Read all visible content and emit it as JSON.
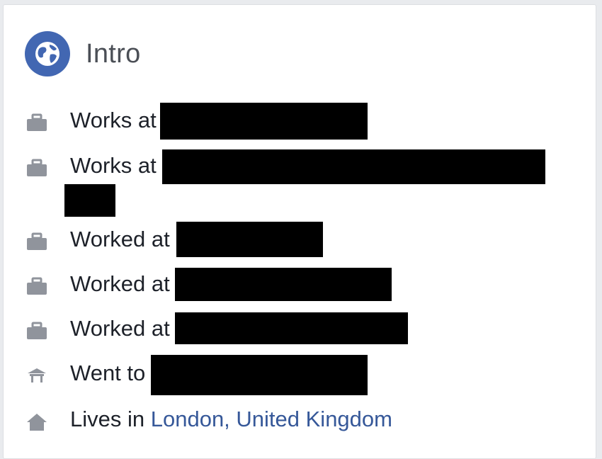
{
  "intro": {
    "title": "Intro",
    "header_icon": "globe-icon",
    "accent_color": "#4267b2"
  },
  "rows": [
    {
      "icon": "briefcase-icon",
      "label": "Works at",
      "value": "[redacted]"
    },
    {
      "icon": "briefcase-icon",
      "label": "Works at",
      "value": "[redacted]"
    },
    {
      "icon": "briefcase-icon",
      "label": "Worked at",
      "value": "[redacted]"
    },
    {
      "icon": "briefcase-icon",
      "label": "Worked at",
      "value": "[redacted]"
    },
    {
      "icon": "briefcase-icon",
      "label": "Worked at",
      "value": "[redacted]"
    },
    {
      "icon": "school-icon",
      "label": "Went to",
      "value": "[redacted]"
    },
    {
      "icon": "home-icon",
      "label": "Lives in",
      "value": "London, United Kingdom"
    }
  ]
}
